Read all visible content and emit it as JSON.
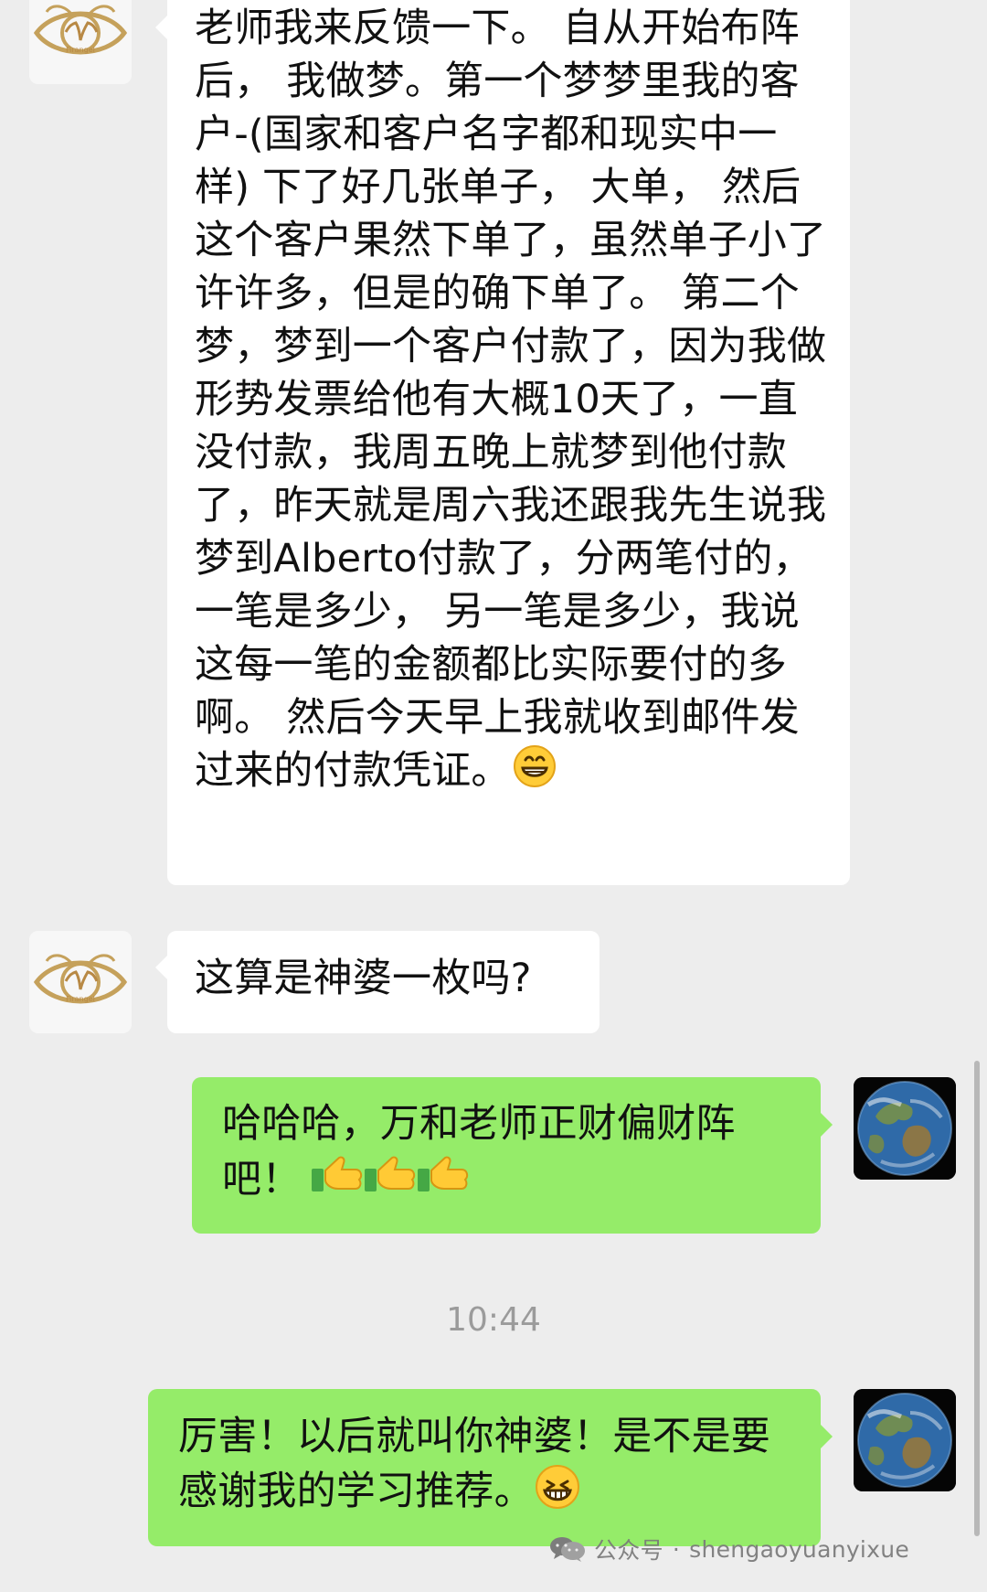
{
  "messages": [
    {
      "text": "老师我来反馈一下。 自从开始布阵后， 我做梦。第一个梦梦里我的客户-(国家和客户名字都和现实中一样) 下了好几张单子， 大单， 然后这个客户果然下单了，虽然单子小了许许多，但是的确下单了。 第二个梦，梦到一个客户付款了，因为我做形势发票给他有大概10天了，一直没付款，我周五晚上就梦到他付款了，昨天就是周六我还跟我先生说我梦到Alberto付款了，分两笔付的， 一笔是多少， 另一笔是多少，我说这每一笔的金额都比实际要付的多啊。 然后今天早上我就收到邮件发过来的付款凭证。",
      "emoji": "grinning-face-emoji"
    },
    {
      "text": "这算是神婆一枚吗?"
    },
    {
      "text": "哈哈哈，万和老师正财偏财阵吧！",
      "emoji": "thumbs-up-emoji"
    },
    {
      "text": "厉害！以后就叫你神婆！是不是要感谢我的学习推荐。",
      "emoji": "beaming-face-emoji"
    }
  ],
  "timestamp": "10:44",
  "watermark": {
    "source": "公众号",
    "separator": "·",
    "account": "shengaoyuanyixue"
  },
  "colors": {
    "background": "#ededed",
    "received_bubble": "#ffffff",
    "sent_bubble": "#95ec69",
    "timestamp": "#9b9b9b",
    "logo_gold": "#c5a15b"
  },
  "icons": {
    "contact_avatar": "golden-eye-logo",
    "user_avatar": "earth-globe",
    "watermark": "wechat-icon"
  }
}
